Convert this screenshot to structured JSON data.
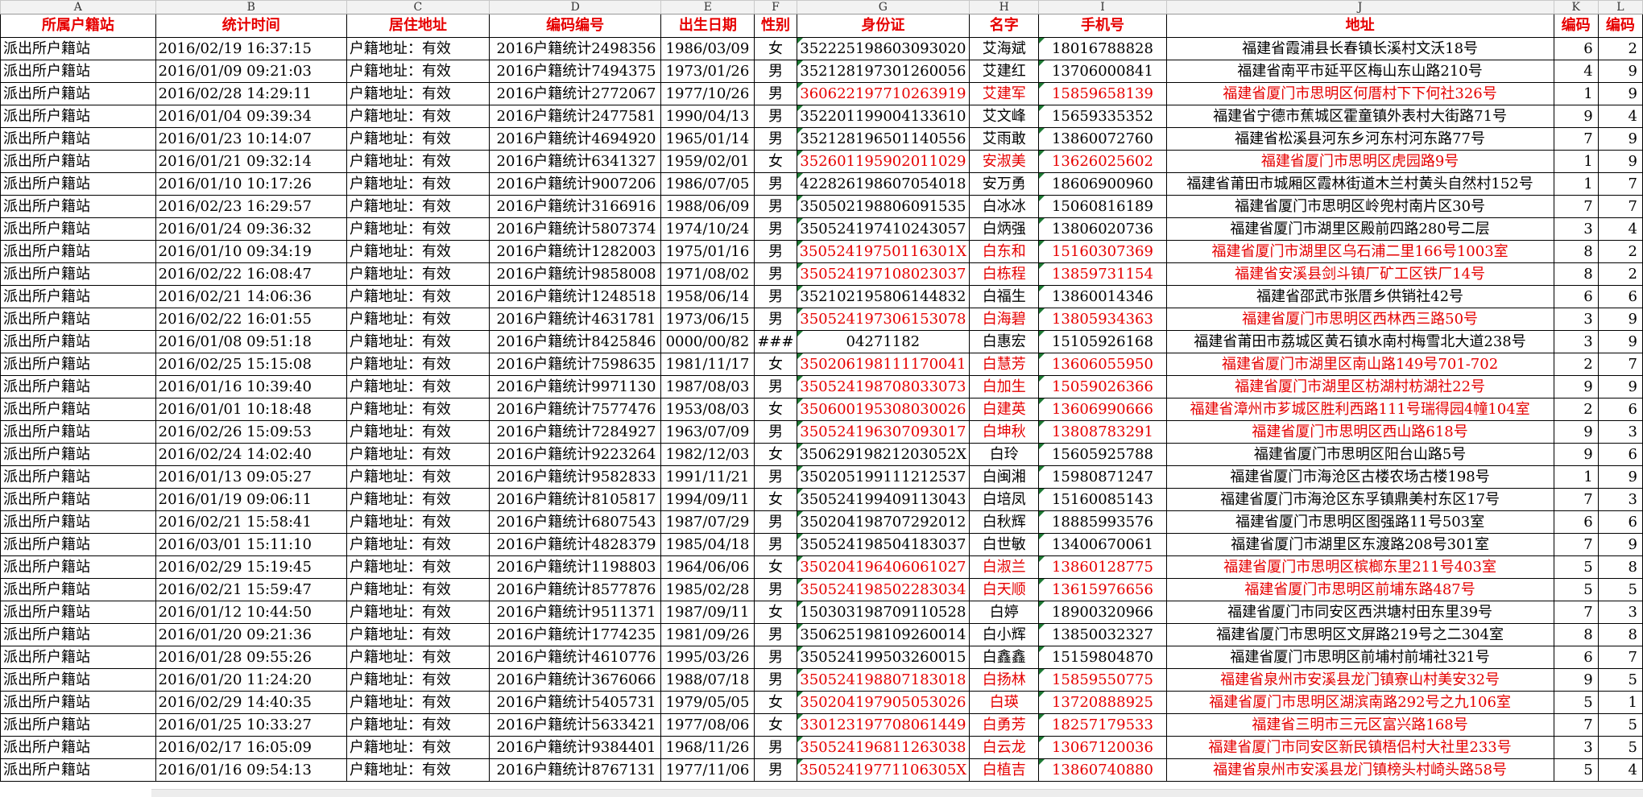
{
  "column_letters": [
    "A",
    "B",
    "C",
    "D",
    "E",
    "F",
    "G",
    "H",
    "I",
    "J",
    "K",
    "L"
  ],
  "headers": [
    "所属户籍站",
    "统计时间",
    "居住地址",
    "编码编号",
    "出生日期",
    "性别",
    "身份证",
    "名字",
    "手机号",
    "地址",
    "编码",
    "编码"
  ],
  "rows": [
    {
      "station": "派出所户籍站",
      "time": "2016/02/19 16:37:15",
      "residence": "户籍地址：有效",
      "code": "2016户籍统计2498356",
      "birth": "1986/03/09",
      "gender": "女",
      "id": "352225198603093020",
      "name": "艾海斌",
      "phone": "18016788828",
      "address": "福建省霞浦县长春镇长溪村文沃18号",
      "k": "6",
      "l": "2",
      "red": false
    },
    {
      "station": "派出所户籍站",
      "time": "2016/01/09 09:21:03",
      "residence": "户籍地址：有效",
      "code": "2016户籍统计7494375",
      "birth": "1973/01/26",
      "gender": "男",
      "id": "352128197301260056",
      "name": "艾建红",
      "phone": "13706000841",
      "address": "福建省南平市延平区梅山东山路210号",
      "k": "4",
      "l": "9",
      "red": false
    },
    {
      "station": "派出所户籍站",
      "time": "2016/02/28 14:29:11",
      "residence": "户籍地址：有效",
      "code": "2016户籍统计2772067",
      "birth": "1977/10/26",
      "gender": "男",
      "id": "360622197710263919",
      "name": "艾建军",
      "phone": "15859658139",
      "address": "福建省厦门市思明区何厝村下下何社326号",
      "k": "1",
      "l": "9",
      "red": true
    },
    {
      "station": "派出所户籍站",
      "time": "2016/01/04 09:39:34",
      "residence": "户籍地址：有效",
      "code": "2016户籍统计2477581",
      "birth": "1990/04/13",
      "gender": "男",
      "id": "352201199004133610",
      "name": "艾文峰",
      "phone": "15659335352",
      "address": "福建省宁德市蕉城区霍童镇外表村大街路71号",
      "k": "9",
      "l": "4",
      "red": false
    },
    {
      "station": "派出所户籍站",
      "time": "2016/01/23 10:14:07",
      "residence": "户籍地址：有效",
      "code": "2016户籍统计4694920",
      "birth": "1965/01/14",
      "gender": "男",
      "id": "352128196501140556",
      "name": "艾雨敢",
      "phone": "13860072760",
      "address": "福建省松溪县河东乡河东村河东路77号",
      "k": "7",
      "l": "9",
      "red": false
    },
    {
      "station": "派出所户籍站",
      "time": "2016/01/21 09:32:14",
      "residence": "户籍地址：有效",
      "code": "2016户籍统计6341327",
      "birth": "1959/02/01",
      "gender": "女",
      "id": "352601195902011029",
      "name": "安淑美",
      "phone": "13626025602",
      "address": "福建省厦门市思明区虎园路9号",
      "k": "1",
      "l": "9",
      "red": true
    },
    {
      "station": "派出所户籍站",
      "time": "2016/01/10 10:17:26",
      "residence": "户籍地址：有效",
      "code": "2016户籍统计9007206",
      "birth": "1986/07/05",
      "gender": "男",
      "id": "422826198607054018",
      "name": "安万勇",
      "phone": "18606900960",
      "address": "福建省莆田市城厢区霞林街道木兰村黄头自然村152号",
      "k": "1",
      "l": "7",
      "red": false
    },
    {
      "station": "派出所户籍站",
      "time": "2016/02/23 16:29:57",
      "residence": "户籍地址：有效",
      "code": "2016户籍统计3166916",
      "birth": "1988/06/09",
      "gender": "男",
      "id": "350502198806091535",
      "name": "白冰冰",
      "phone": "15060816189",
      "address": "福建省厦门市思明区岭兜村南片区30号",
      "k": "7",
      "l": "7",
      "red": false
    },
    {
      "station": "派出所户籍站",
      "time": "2016/01/24 09:36:32",
      "residence": "户籍地址：有效",
      "code": "2016户籍统计5807374",
      "birth": "1974/10/24",
      "gender": "男",
      "id": "350524197410243057",
      "name": "白炳强",
      "phone": "13806020736",
      "address": "福建省厦门市湖里区殿前四路280号二层",
      "k": "3",
      "l": "4",
      "red": false
    },
    {
      "station": "派出所户籍站",
      "time": "2016/01/10 09:34:19",
      "residence": "户籍地址：有效",
      "code": "2016户籍统计1282003",
      "birth": "1975/01/16",
      "gender": "男",
      "id": "35052419750116301X",
      "name": "白东和",
      "phone": "15160307369",
      "address": "福建省厦门市湖里区乌石浦二里166号1003室",
      "k": "8",
      "l": "2",
      "red": true
    },
    {
      "station": "派出所户籍站",
      "time": "2016/02/22 16:08:47",
      "residence": "户籍地址：有效",
      "code": "2016户籍统计9858008",
      "birth": "1971/08/02",
      "gender": "男",
      "id": "350524197108023037",
      "name": "白栋程",
      "phone": "13859731154",
      "address": "福建省安溪县剑斗镇厂矿工区铁厂14号",
      "k": "8",
      "l": "2",
      "red": true
    },
    {
      "station": "派出所户籍站",
      "time": "2016/02/21 14:06:36",
      "residence": "户籍地址：有效",
      "code": "2016户籍统计1248518",
      "birth": "1958/06/14",
      "gender": "男",
      "id": "352102195806144832",
      "name": "白福生",
      "phone": "13860014346",
      "address": "福建省邵武市张厝乡供销社42号",
      "k": "6",
      "l": "6",
      "red": false
    },
    {
      "station": "派出所户籍站",
      "time": "2016/02/22 16:01:55",
      "residence": "户籍地址：有效",
      "code": "2016户籍统计4631781",
      "birth": "1973/06/15",
      "gender": "男",
      "id": "350524197306153078",
      "name": "白海碧",
      "phone": "13805934363",
      "address": "福建省厦门市思明区西林西三路50号",
      "k": "3",
      "l": "9",
      "red": true
    },
    {
      "station": "派出所户籍站",
      "time": "2016/01/08 09:51:18",
      "residence": "户籍地址：有效",
      "code": "2016户籍统计8425846",
      "birth": "0000/00/82",
      "gender": "###",
      "id": "04271182",
      "name": "白惠宏",
      "phone": "15105926168",
      "address": "福建省莆田市荔城区黄石镇水南村梅雪北大道238号",
      "k": "3",
      "l": "9",
      "red": false
    },
    {
      "station": "派出所户籍站",
      "time": "2016/02/25 15:15:08",
      "residence": "户籍地址：有效",
      "code": "2016户籍统计7598635",
      "birth": "1981/11/17",
      "gender": "女",
      "id": "350206198111170041",
      "name": "白慧芳",
      "phone": "13606055950",
      "address": "福建省厦门市湖里区南山路149号701-702",
      "k": "2",
      "l": "7",
      "red": true
    },
    {
      "station": "派出所户籍站",
      "time": "2016/01/16 10:39:40",
      "residence": "户籍地址：有效",
      "code": "2016户籍统计9971130",
      "birth": "1987/08/03",
      "gender": "男",
      "id": "350524198708033073",
      "name": "白加生",
      "phone": "15059026366",
      "address": "福建省厦门市湖里区枋湖村枋湖社22号",
      "k": "9",
      "l": "9",
      "red": true
    },
    {
      "station": "派出所户籍站",
      "time": "2016/01/01 10:18:48",
      "residence": "户籍地址：有效",
      "code": "2016户籍统计7577476",
      "birth": "1953/08/03",
      "gender": "女",
      "id": "350600195308030026",
      "name": "白建英",
      "phone": "13606990666",
      "address": "福建省漳州市芗城区胜利西路111号瑞得园4幢104室",
      "k": "2",
      "l": "6",
      "red": true
    },
    {
      "station": "派出所户籍站",
      "time": "2016/02/26 15:09:53",
      "residence": "户籍地址：有效",
      "code": "2016户籍统计7284927",
      "birth": "1963/07/09",
      "gender": "男",
      "id": "350524196307093017",
      "name": "白坤秋",
      "phone": "13808783291",
      "address": "福建省厦门市思明区西山路618号",
      "k": "9",
      "l": "3",
      "red": true
    },
    {
      "station": "派出所户籍站",
      "time": "2016/02/24 14:02:40",
      "residence": "户籍地址：有效",
      "code": "2016户籍统计9223264",
      "birth": "1982/12/03",
      "gender": "女",
      "id": "35062919821203052X",
      "name": "白玲",
      "phone": "15605925788",
      "address": "福建省厦门市思明区阳台山路5号",
      "k": "9",
      "l": "6",
      "red": false
    },
    {
      "station": "派出所户籍站",
      "time": "2016/01/13 09:05:27",
      "residence": "户籍地址：有效",
      "code": "2016户籍统计9582833",
      "birth": "1991/11/21",
      "gender": "男",
      "id": "350205199111212537",
      "name": "白闽湘",
      "phone": "15980871247",
      "address": "福建省厦门市海沧区古楼农场古楼198号",
      "k": "1",
      "l": "9",
      "red": false
    },
    {
      "station": "派出所户籍站",
      "time": "2016/01/19 09:06:11",
      "residence": "户籍地址：有效",
      "code": "2016户籍统计8105817",
      "birth": "1994/09/11",
      "gender": "女",
      "id": "350524199409113043",
      "name": "白培凤",
      "phone": "15160085143",
      "address": "福建省厦门市海沧区东孚镇鼎美村东区17号",
      "k": "7",
      "l": "3",
      "red": false
    },
    {
      "station": "派出所户籍站",
      "time": "2016/02/21 15:58:41",
      "residence": "户籍地址：有效",
      "code": "2016户籍统计6807543",
      "birth": "1987/07/29",
      "gender": "男",
      "id": "350204198707292012",
      "name": "白秋辉",
      "phone": "18885993576",
      "address": "福建省厦门市思明区图强路11号503室",
      "k": "6",
      "l": "6",
      "red": false
    },
    {
      "station": "派出所户籍站",
      "time": "2016/03/01 15:11:10",
      "residence": "户籍地址：有效",
      "code": "2016户籍统计4828379",
      "birth": "1985/04/18",
      "gender": "男",
      "id": "350524198504183037",
      "name": "白世敏",
      "phone": "13400670061",
      "address": "福建省厦门市湖里区东渡路208号301室",
      "k": "7",
      "l": "9",
      "red": false
    },
    {
      "station": "派出所户籍站",
      "time": "2016/02/29 15:19:45",
      "residence": "户籍地址：有效",
      "code": "2016户籍统计1198803",
      "birth": "1964/06/06",
      "gender": "女",
      "id": "350204196406061027",
      "name": "白淑兰",
      "phone": "13860128775",
      "address": "福建省厦门市思明区槟榔东里211号403室",
      "k": "5",
      "l": "8",
      "red": true
    },
    {
      "station": "派出所户籍站",
      "time": "2016/02/21 15:59:47",
      "residence": "户籍地址：有效",
      "code": "2016户籍统计8577876",
      "birth": "1985/02/28",
      "gender": "男",
      "id": "350524198502283034",
      "name": "白天顺",
      "phone": "13615976656",
      "address": "福建省厦门市思明区前埔东路487号",
      "k": "5",
      "l": "5",
      "red": true
    },
    {
      "station": "派出所户籍站",
      "time": "2016/01/12 10:44:50",
      "residence": "户籍地址：有效",
      "code": "2016户籍统计9511371",
      "birth": "1987/09/11",
      "gender": "女",
      "id": "150303198709110528",
      "name": "白婷",
      "phone": "18900320966",
      "address": "福建省厦门市同安区西洪塘村田东里39号",
      "k": "7",
      "l": "3",
      "red": false
    },
    {
      "station": "派出所户籍站",
      "time": "2016/01/20 09:21:36",
      "residence": "户籍地址：有效",
      "code": "2016户籍统计1774235",
      "birth": "1981/09/26",
      "gender": "男",
      "id": "350625198109260014",
      "name": "白小辉",
      "phone": "13850032327",
      "address": "福建省厦门市思明区文屏路219号之二304室",
      "k": "8",
      "l": "8",
      "red": false
    },
    {
      "station": "派出所户籍站",
      "time": "2016/01/28 09:55:26",
      "residence": "户籍地址：有效",
      "code": "2016户籍统计4610776",
      "birth": "1995/03/26",
      "gender": "男",
      "id": "350524199503260015",
      "name": "白鑫鑫",
      "phone": "15159804870",
      "address": "福建省厦门市思明区前埔村前埔社321号",
      "k": "6",
      "l": "7",
      "red": false
    },
    {
      "station": "派出所户籍站",
      "time": "2016/01/20 11:24:20",
      "residence": "户籍地址：有效",
      "code": "2016户籍统计3676066",
      "birth": "1988/07/18",
      "gender": "男",
      "id": "350524198807183018",
      "name": "白扬林",
      "phone": "15859550775",
      "address": "福建省泉州市安溪县龙门镇寮山村美安32号",
      "k": "9",
      "l": "5",
      "red": true
    },
    {
      "station": "派出所户籍站",
      "time": "2016/02/29 14:40:35",
      "residence": "户籍地址：有效",
      "code": "2016户籍统计5405731",
      "birth": "1979/05/05",
      "gender": "女",
      "id": "350204197905053026",
      "name": "白瑛",
      "phone": "13720888925",
      "address": "福建省厦门市思明区湖滨南路292号之九106室",
      "k": "5",
      "l": "1",
      "red": true
    },
    {
      "station": "派出所户籍站",
      "time": "2016/01/25 10:33:27",
      "residence": "户籍地址：有效",
      "code": "2016户籍统计5633421",
      "birth": "1977/08/06",
      "gender": "女",
      "id": "330123197708061449",
      "name": "白勇芳",
      "phone": "18257179533",
      "address": "福建省三明市三元区富兴路168号",
      "k": "7",
      "l": "5",
      "red": true
    },
    {
      "station": "派出所户籍站",
      "time": "2016/02/17 16:05:09",
      "residence": "户籍地址：有效",
      "code": "2016户籍统计9384401",
      "birth": "1968/11/26",
      "gender": "男",
      "id": "350524196811263038",
      "name": "白云龙",
      "phone": "13067120036",
      "address": "福建省厦门市同安区新民镇梧侣村大社里233号",
      "k": "3",
      "l": "5",
      "red": true
    },
    {
      "station": "派出所户籍站",
      "time": "2016/01/16 09:54:13",
      "residence": "户籍地址：有效",
      "code": "2016户籍统计8767131",
      "birth": "1977/11/06",
      "gender": "男",
      "id": "35052419771106305X",
      "name": "白植吉",
      "phone": "13860740880",
      "address": "福建省泉州市安溪县龙门镇榜头村崎头路58号",
      "k": "5",
      "l": "4",
      "red": true
    }
  ]
}
